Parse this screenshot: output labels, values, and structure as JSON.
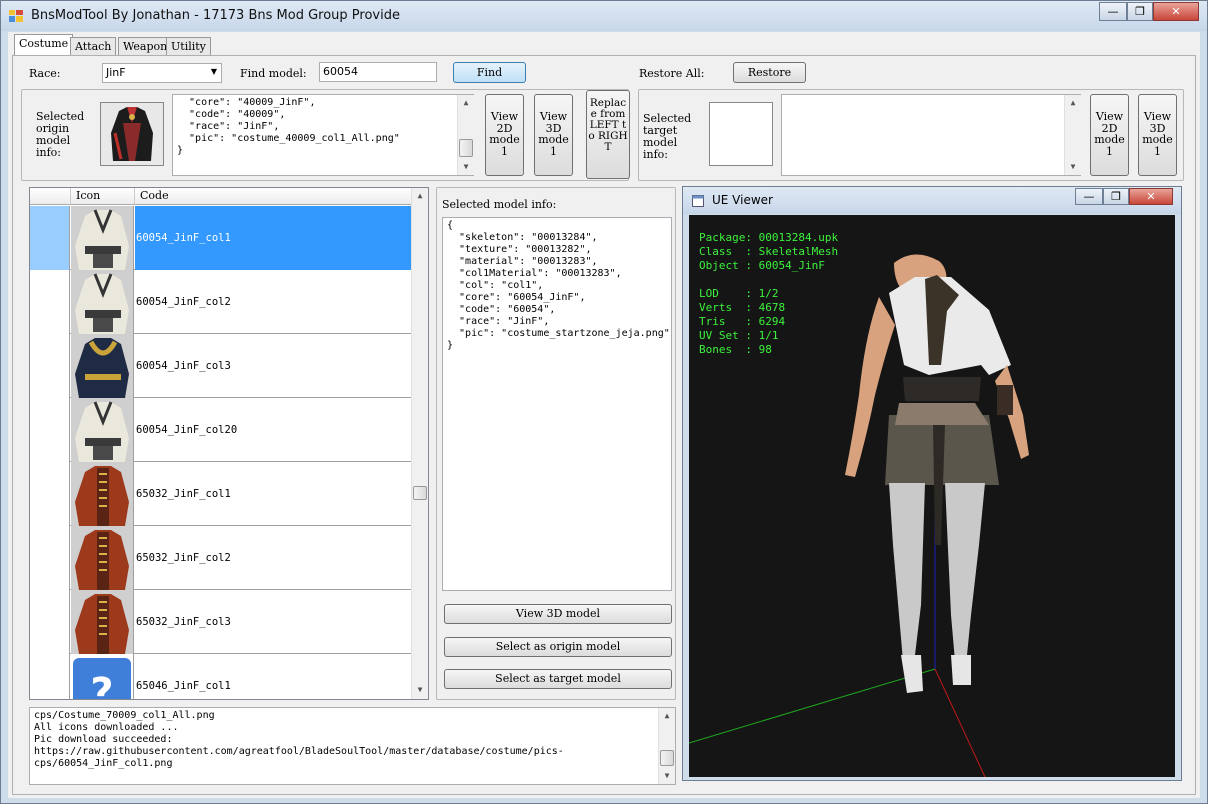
{
  "window": {
    "title": "BnsModTool By Jonathan - 17173 Bns Mod Group Provide",
    "controls": [
      "—",
      "❐",
      "✕"
    ]
  },
  "tabs": [
    "Costume",
    "Attach",
    "Weapon",
    "Utility"
  ],
  "search": {
    "race_label": "Race:",
    "race_value": "JinF",
    "find_label": "Find model:",
    "find_value": "60054",
    "find_button": "Find",
    "restore_label": "Restore All:",
    "restore_button": "Restore"
  },
  "origin": {
    "label": "Selected origin model info:",
    "info": "  \"core\": \"40009_JinF\",\n  \"code\": \"40009\",\n  \"race\": \"JinF\",\n  \"pic\": \"costume_40009_col1_All.png\"\n}",
    "view2d": "View 2D mode 1",
    "view3d": "View 3D mode 1"
  },
  "replace_button": "Replace from LEFT to RIGHT",
  "target": {
    "label": "Selected target model info:",
    "info": "",
    "view2d": "View 2D mode 1",
    "view3d": "View 3D mode 1"
  },
  "grid": {
    "headers": [
      "",
      "Icon",
      "Code"
    ],
    "rows": [
      {
        "code": "60054_JinF_col1",
        "icon": "white-robe-icon",
        "selected": true
      },
      {
        "code": "60054_JinF_col2",
        "icon": "white-robe-icon",
        "selected": false
      },
      {
        "code": "60054_JinF_col3",
        "icon": "navy-robe-icon",
        "selected": false
      },
      {
        "code": "60054_JinF_col20",
        "icon": "white-robe-icon",
        "selected": false
      },
      {
        "code": "65032_JinF_col1",
        "icon": "red-coat-icon",
        "selected": false
      },
      {
        "code": "65032_JinF_col2",
        "icon": "red-coat-icon",
        "selected": false
      },
      {
        "code": "65032_JinF_col3",
        "icon": "red-coat-icon",
        "selected": false
      },
      {
        "code": "65046_JinF_col1",
        "icon": "unknown-question-icon",
        "selected": false
      }
    ]
  },
  "selected_info": {
    "label": "Selected model info:",
    "json": "{\n  \"skeleton\": \"00013284\",\n  \"texture\": \"00013282\",\n  \"material\": \"00013283\",\n  \"col1Material\": \"00013283\",\n  \"col\": \"col1\",\n  \"core\": \"60054_JinF\",\n  \"code\": \"60054\",\n  \"race\": \"JinF\",\n  \"pic\": \"costume_startzone_jeja.png\"\n}",
    "view3d_button": "View 3D model",
    "origin_button": "Select as origin model",
    "target_button": "Select as target model"
  },
  "log": "cps/Costume_70009_col1_All.png\nAll icons downloaded ...\nPic download succeeded:\nhttps://raw.githubusercontent.com/agreatfool/BladeSoulTool/master/database/costume/pics-\ncps/60054_JinF_col1.png",
  "ue_viewer": {
    "title": "UE Viewer",
    "stats": "Package: 00013284.upk\nClass  : SkeletalMesh\nObject : 60054_JinF\n\nLOD    : 1/2\nVerts  : 4678\nTris   : 6294\nUV Set : 1/1\nBones  : 98"
  },
  "colors": {
    "selection": "#3399ff",
    "stats_text": "#3cf23c",
    "viewport_bg": "#151515"
  }
}
